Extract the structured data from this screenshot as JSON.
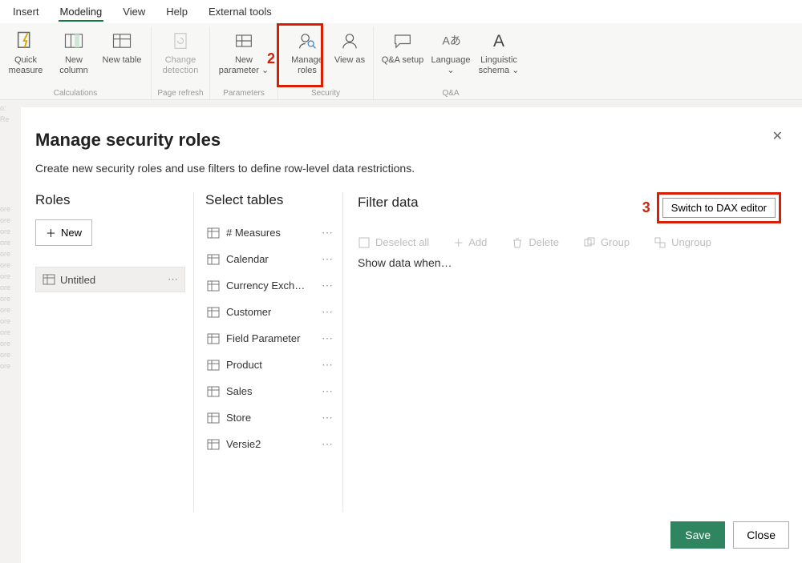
{
  "tabs": {
    "insert": "Insert",
    "modeling": "Modeling",
    "view": "View",
    "help": "Help",
    "external": "External tools"
  },
  "ribbon": {
    "calc": {
      "quick": "Quick measure",
      "newcol": "New column",
      "newtbl": "New table",
      "label": "Calculations"
    },
    "refresh": {
      "change": "Change detection",
      "label": "Page refresh"
    },
    "param": {
      "new": "New parameter ⌄",
      "label": "Parameters"
    },
    "security": {
      "manage": "Manage roles",
      "viewas": "View as",
      "label": "Security"
    },
    "qa": {
      "setup": "Q&A setup",
      "lang": "Language ⌄",
      "ling": "Linguistic schema ⌄",
      "label": "Q&A"
    }
  },
  "annot": {
    "n2": "2",
    "n3": "3"
  },
  "dialog": {
    "title": "Manage security roles",
    "subtitle": "Create new security roles and use filters to define row-level data restrictions.",
    "roles_h": "Roles",
    "new_btn": "New",
    "role_untitled": "Untitled",
    "tables_h": "Select tables",
    "tables": [
      "# Measures",
      "Calendar",
      "Currency Exch…",
      "Customer",
      "Field Parameter",
      "Product",
      "Sales",
      "Store",
      "Versie2"
    ],
    "filter_h": "Filter data",
    "dax_btn": "Switch to DAX editor",
    "toolbar": {
      "deselect": "Deselect all",
      "add": "Add",
      "delete": "Delete",
      "group": "Group",
      "ungroup": "Ungroup"
    },
    "show_when": "Show data when…",
    "save": "Save",
    "close": "Close"
  }
}
